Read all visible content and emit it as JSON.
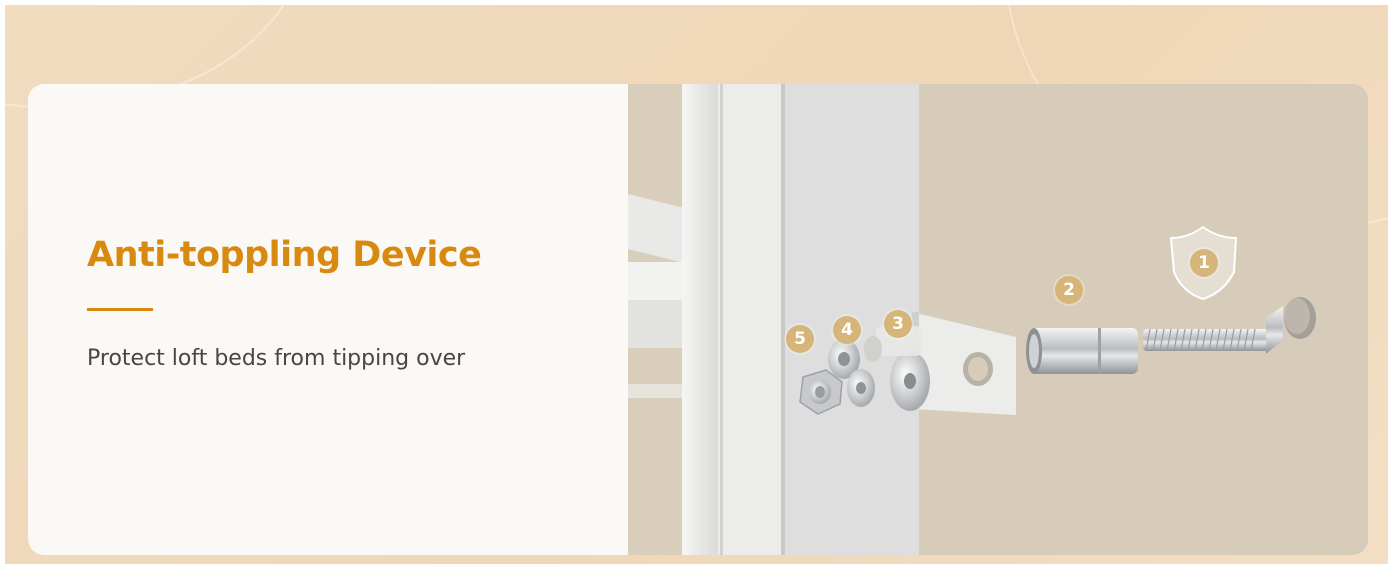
{
  "title": "Anti-toppling Device",
  "subtitle": "Protect loft beds from tipping over",
  "badges": [
    "1",
    "2",
    "3",
    "4",
    "5"
  ],
  "colors": {
    "accent": "#d88a10",
    "background": "#efd6b6",
    "card_left": "#fbf9f5",
    "photo_wall": "#d6ccb9",
    "badge": "#d6b57a"
  },
  "icons": [
    "shield-icon"
  ]
}
